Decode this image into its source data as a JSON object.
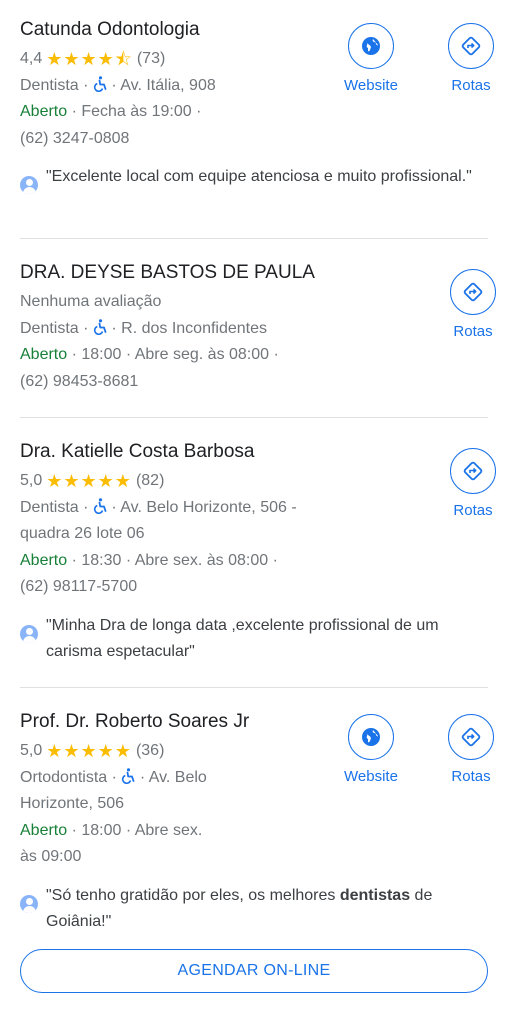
{
  "colors": {
    "accent": "#1a73e8",
    "open": "#188038",
    "star": "#fbbc04"
  },
  "listings": [
    {
      "name": "Catunda Odontologia",
      "rating": "4,4",
      "stars": "★★★★⯪",
      "reviews_count": "(73)",
      "category": "Dentista",
      "address": "Av. Itália, 908",
      "status": "Aberto",
      "hours": "Fecha às 19:00",
      "phone": "(62) 3247-0808",
      "review": "\"Excelente local com equipe atenciosa e muito profissional.\"",
      "website_label": "Website",
      "routes_label": "Rotas"
    },
    {
      "name": "DRA. DEYSE BASTOS DE PAULA",
      "no_reviews": "Nenhuma avaliação",
      "category": "Dentista",
      "address": "R. dos Inconfidentes",
      "status": "Aberto",
      "hours": "18:00 · Abre seg. às 08:00",
      "phone": "(62) 98453-8681",
      "routes_label": "Rotas"
    },
    {
      "name": "Dra. Katielle Costa Barbosa",
      "rating": "5,0",
      "stars": "★★★★★",
      "reviews_count": "(82)",
      "category": "Dentista",
      "address_line1": "Av. Belo Horizonte, 506 -",
      "address_line2": "quadra 26 lote 06",
      "status": "Aberto",
      "hours": "18:30 · Abre sex. às 08:00",
      "phone": "(62) 98117-5700",
      "review": "\"Minha Dra de longa data ,excelente profissional de um carisma espetacular\"",
      "routes_label": "Rotas"
    },
    {
      "name": "Prof. Dr. Roberto Soares Jr",
      "rating": "5,0",
      "stars": "★★★★★",
      "reviews_count": "(36)",
      "category": "Ortodontista",
      "address_line1": "Av. Belo",
      "address_line2": "Horizonte, 506",
      "status": "Aberto",
      "hours_line1": "18:00 · Abre sex.",
      "hours_line2": "às 09:00",
      "review_before": "\"Só tenho gratidão por eles, os melhores ",
      "review_bold": "dentistas",
      "review_after": " de Goiânia!\"",
      "website_label": "Website",
      "routes_label": "Rotas",
      "cta_label": "AGENDAR ON-LINE"
    }
  ]
}
